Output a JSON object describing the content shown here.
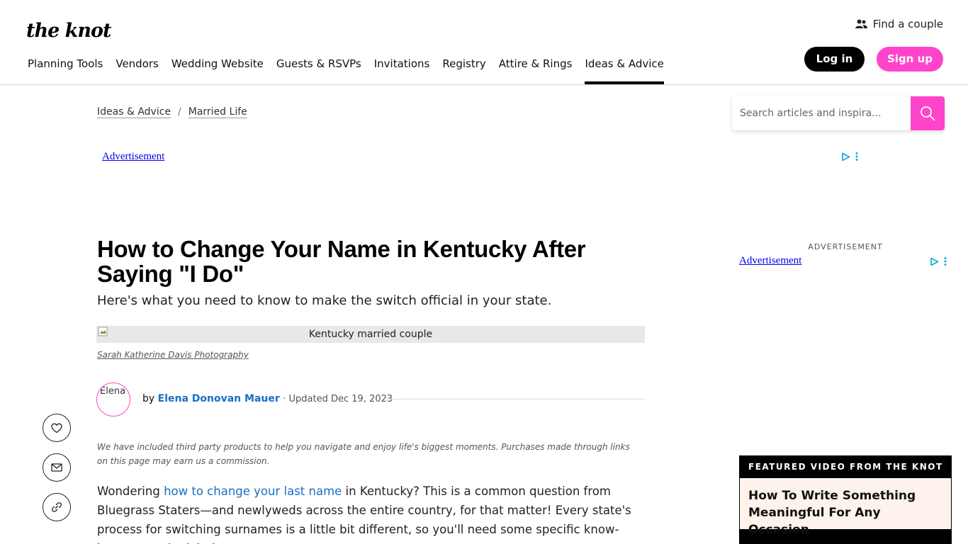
{
  "header": {
    "logo": "the knot",
    "find_couple": "Find a couple",
    "login": "Log in",
    "signup": "Sign up",
    "nav": [
      "Planning Tools",
      "Vendors",
      "Wedding Website",
      "Guests & RSVPs",
      "Invitations",
      "Registry",
      "Attire & Rings",
      "Ideas & Advice"
    ],
    "active_nav": "Ideas & Advice"
  },
  "breadcrumb": {
    "first": "Ideas & Advice",
    "separator": "/",
    "second": "Married Life"
  },
  "search": {
    "placeholder": "Search articles and inspira..."
  },
  "ads": {
    "top_alt": "Advertisement",
    "side_label": "ADVERTISEMENT",
    "side_alt": "Advertisement"
  },
  "article": {
    "title": "How to Change Your Name in Kentucky After Saying \"I Do\"",
    "subtitle": "Here's what you need to know to make the switch official in your state.",
    "hero_alt": "Kentucky married couple",
    "photo_credit": "Sarah Katherine Davis Photography",
    "avatar_alt": "Elena",
    "by": "by",
    "author": "Elena Donovan Mauer",
    "updated": "· Updated Dec 19, 2023",
    "disclaimer": "We have included third party products to help you navigate and enjoy life's biggest moments. Purchases made through links on this page may earn us a commission.",
    "body_before_link": "Wondering ",
    "body_link": "how to change your last name",
    "body_after_link": " in Kentucky? This is a common question from Bluegrass Staters—and newlyweds across the entire country, for that matter! Every state's process for switching surnames is a little bit different, so you'll need some specific know-how to get the job done."
  },
  "featured_video": {
    "heading": "FEATURED VIDEO FROM THE KNOT",
    "title": "How To Write Something Meaningful For Any Occasion"
  },
  "colors": {
    "brand_pink": "#ff44cb",
    "link_blue": "#1a6fc4",
    "ad_cyan": "#19a8d6"
  }
}
